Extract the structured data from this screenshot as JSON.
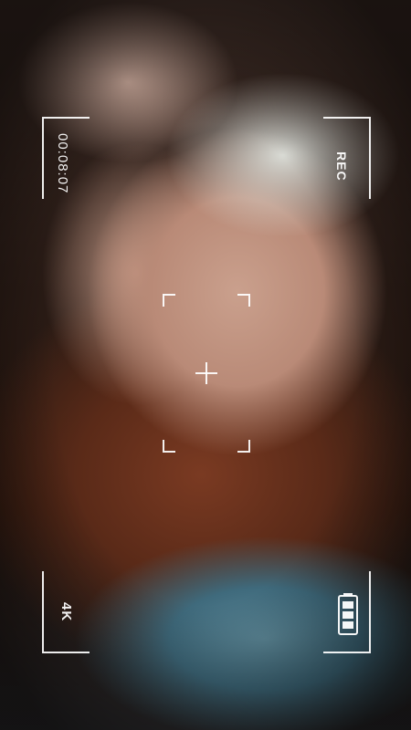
{
  "viewfinder": {
    "timer": "00:08:07",
    "rec_label": "REC",
    "quality_label": "4K",
    "battery_level": 1.0,
    "battery_bars": 3,
    "focus_icon": "crosshair-plus-icon",
    "battery_icon": "battery-icon"
  }
}
